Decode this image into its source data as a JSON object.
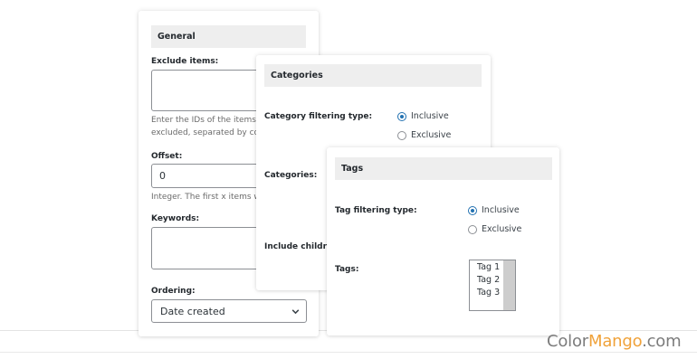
{
  "general": {
    "title": "General",
    "exclude_label": "Exclude items:",
    "exclude_desc_1": "Enter the IDs of the items to",
    "exclude_desc_2": "excluded, separated by com",
    "offset_label": "Offset:",
    "offset_value": "0",
    "offset_desc": "Integer. The first x items wil",
    "keywords_label": "Keywords:",
    "ordering_label": "Ordering:",
    "ordering_value": "Date created"
  },
  "categories": {
    "title": "Categories",
    "filter_label": "Category filtering type:",
    "inclusive": "Inclusive",
    "exclusive": "Exclusive",
    "selected": "Inclusive",
    "categories_label": "Categories:",
    "include_children_label": "Include childrer"
  },
  "tags": {
    "title": "Tags",
    "filter_label": "Tag filtering type:",
    "inclusive": "Inclusive",
    "exclusive": "Exclusive",
    "selected": "Inclusive",
    "tags_label": "Tags:",
    "options": [
      "Tag 1",
      "Tag 2",
      "Tag 3"
    ]
  },
  "watermark": {
    "part1": "Color",
    "part2": "Mango",
    "part3": ".com"
  },
  "colors": {
    "accent": "#2271b1",
    "section_bg": "#eeeeee",
    "watermark_orange": "#f0a23a",
    "watermark_gray": "#7c7c7c"
  },
  "icons": {
    "select_arrow": "chevron-down-icon"
  }
}
